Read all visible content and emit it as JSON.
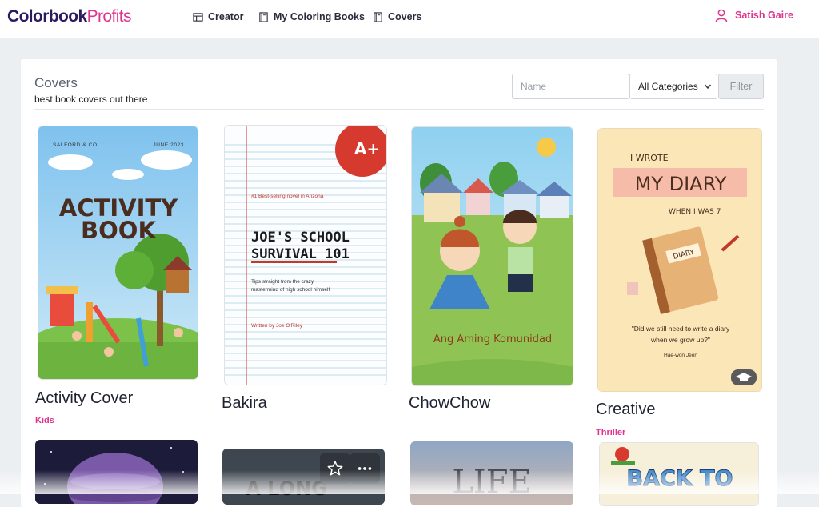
{
  "header": {
    "logo_part1": "Colorbook",
    "logo_part2": "Profits",
    "nav": [
      {
        "label": "Creator",
        "icon": "table-icon"
      },
      {
        "label": "My Coloring Books",
        "icon": "book-icon"
      },
      {
        "label": "Covers",
        "icon": "book-icon"
      }
    ],
    "user_name": "Satish Gaire"
  },
  "main": {
    "title": "Covers",
    "subtitle": "best book covers out there",
    "name_placeholder": "Name",
    "category_selected": "All Categories",
    "filter_label": "Filter"
  },
  "covers": [
    {
      "title": "Activity Cover",
      "category": "Kids",
      "art": {
        "top_left": "SALFORD & CO.",
        "top_right": "JUNE 2023",
        "line1": "ACTIVITY",
        "line2": "BOOK"
      }
    },
    {
      "title": "Bakira",
      "category": "",
      "art": {
        "badge": "A+",
        "tagline": "#1 Best-selling novel in Arizona",
        "line1": "JOE'S SCHOOL",
        "line2": "SURVIVAL 101",
        "desc1": "Tips straight from the crazy",
        "desc2": "mastermind of high school himself",
        "author": "Written by Joe O'Riley"
      }
    },
    {
      "title": "ChowChow",
      "category": "",
      "art": {
        "caption": "Ang Aming Komunidad"
      }
    },
    {
      "title": "Creative",
      "category": "Thriller",
      "art": {
        "line1": "I WROTE",
        "line2": "MY DIARY",
        "line3": "WHEN I WAS 7",
        "diary_label": "DIARY",
        "quote1": "\"Did we still need to write a diary",
        "quote2": "when we grow up?\"",
        "author": "Hae-won Jeon"
      }
    }
  ],
  "second_row": [
    {
      "art_text": ""
    },
    {
      "art_text": "A LONG"
    },
    {
      "art_text": "LIFE"
    },
    {
      "art_text": "BACK TO"
    }
  ],
  "colors": {
    "accent": "#e0328f",
    "brand_dark": "#2a1a5e",
    "page_bg": "#eceff2"
  }
}
